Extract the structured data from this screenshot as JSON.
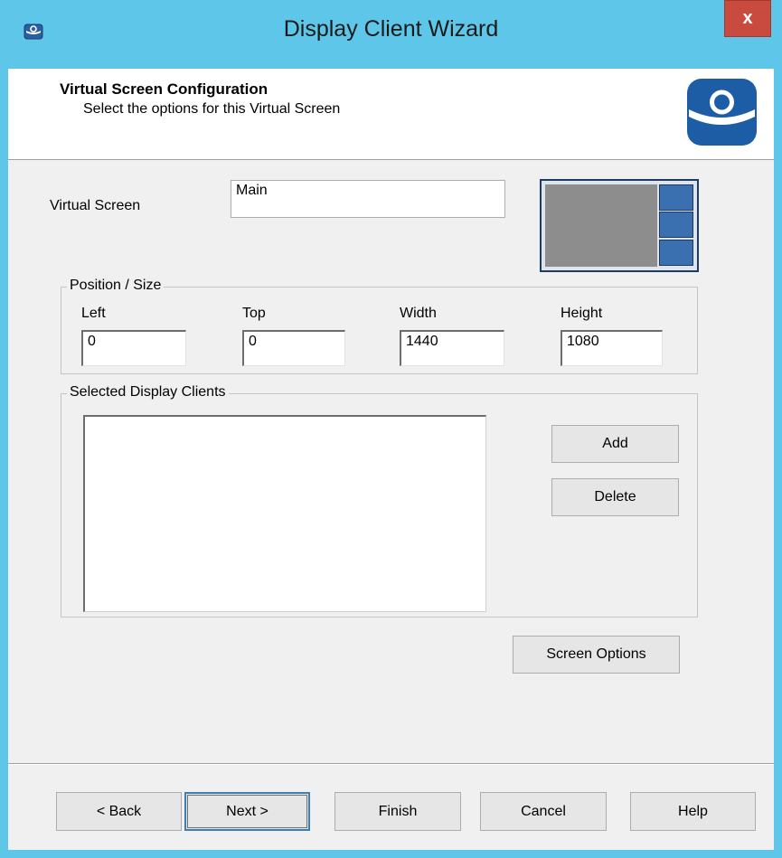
{
  "window": {
    "title": "Display Client Wizard",
    "close_label": "x"
  },
  "header": {
    "title": "Virtual Screen Configuration",
    "subtitle": "Select the options for this Virtual Screen"
  },
  "virtual_screen": {
    "label": "Virtual Screen",
    "value": "Main"
  },
  "position_size": {
    "legend": "Position / Size",
    "left": {
      "label": "Left",
      "value": "0"
    },
    "top": {
      "label": "Top",
      "value": "0"
    },
    "width": {
      "label": "Width",
      "value": "1440"
    },
    "height": {
      "label": "Height",
      "value": "1080"
    }
  },
  "clients": {
    "legend": "Selected Display Clients",
    "items": [],
    "add_label": "Add",
    "delete_label": "Delete"
  },
  "screen_options_label": "Screen Options",
  "footer": {
    "back_label": "< Back",
    "next_label": "Next >",
    "finish_label": "Finish",
    "cancel_label": "Cancel",
    "help_label": "Help"
  },
  "colors": {
    "title_bar": "#5ec6e9",
    "close_button": "#c94a3f",
    "logo_blue": "#1d5da6",
    "preview_tile": "#3a6fb0"
  },
  "icons": {
    "app": "thinmanager-icon",
    "logo": "thinmanager-logo-icon",
    "close": "close-icon"
  }
}
